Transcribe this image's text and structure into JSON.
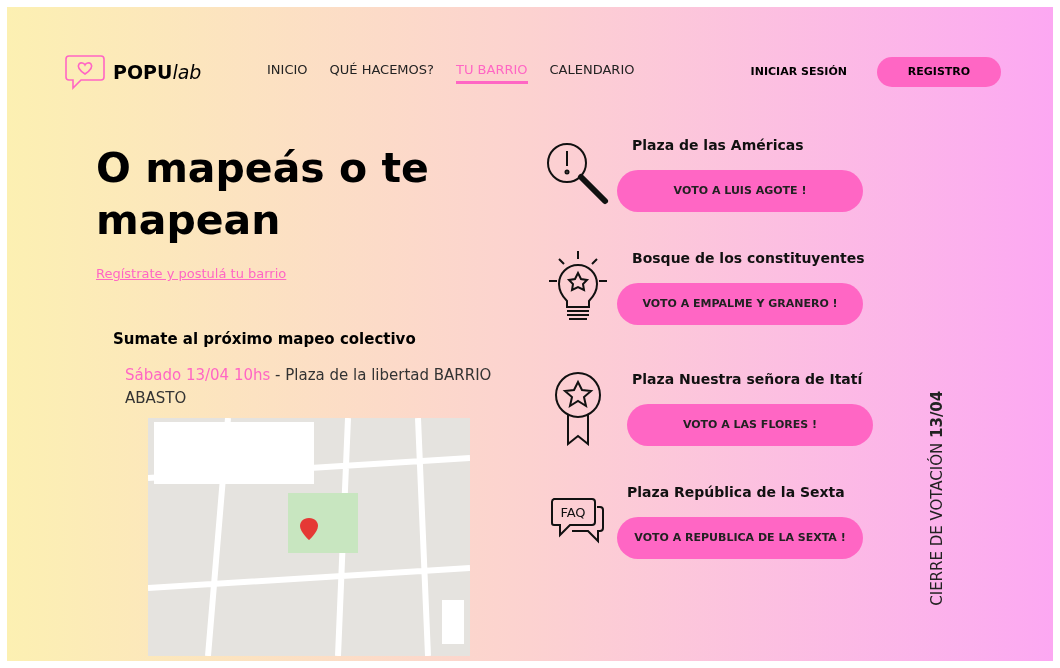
{
  "header": {
    "logo": {
      "brand_bold": "POPU",
      "brand_italic": "lab"
    },
    "nav": [
      {
        "label": "INICIO",
        "selected": false
      },
      {
        "label": "QUÉ HACEMOS?",
        "selected": false
      },
      {
        "label": "TU BARRIO",
        "selected": true
      },
      {
        "label": "CALENDARIO",
        "selected": false
      }
    ],
    "login": "INICIAR SESIÓN",
    "register": "REGISTRO"
  },
  "hero": {
    "title": "O mapeás o te mapean",
    "link": "Regístrate y postulá tu barrio"
  },
  "event": {
    "heading": "Sumate al próximo mapeo colectivo",
    "date": "Sábado 13/04 10hs",
    "details": " - Plaza de la libertad BARRIO ABASTO"
  },
  "places": [
    {
      "kind": "magnifier",
      "name": "Plaza de las Américas",
      "button": "VOTO A LUIS AGOTE !"
    },
    {
      "kind": "bulb",
      "name": "Bosque de los constituyentes",
      "button": "VOTO A EMPALME Y GRANERO !"
    },
    {
      "kind": "medal",
      "name": "Plaza Nuestra señora de Itatí",
      "button": "VOTO A LAS FLORES !"
    },
    {
      "kind": "faq",
      "icon_label": "FAQ",
      "name": "Plaza República de la Sexta",
      "button": "VOTO A REPUBLICA DE LA SEXTA !"
    }
  ],
  "deadline": "CIERRE DE VOTACIÓN **13/04**"
}
